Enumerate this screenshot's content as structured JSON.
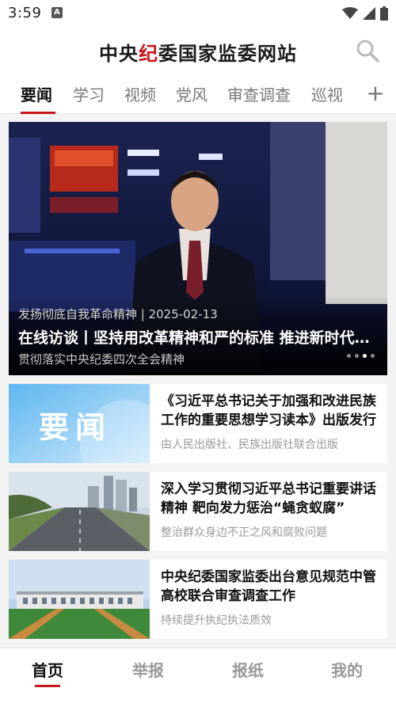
{
  "status_bar": {
    "time": "3:59",
    "app_icon_letter": "A",
    "icons": [
      "wifi-icon",
      "signal-icon",
      "battery-icon"
    ]
  },
  "header": {
    "title_part1": "中央",
    "title_highlight": "纪",
    "title_part2": "委国家监委网站",
    "accent_color": "#c8161d"
  },
  "tabs": [
    {
      "label": "要闻",
      "active": true
    },
    {
      "label": "学习"
    },
    {
      "label": "视频"
    },
    {
      "label": "党风"
    },
    {
      "label": "审查调查"
    },
    {
      "label": "巡视"
    }
  ],
  "tab_add_label": "+",
  "hero": {
    "tag": "发扬彻底自我革命精神 | 2025-02-13",
    "title": "在线访谈丨坚持用改革精神和严的标准 推进新时代纪检监察工作高质量发展",
    "subtitle": "贯彻落实中央纪委四次全会精神",
    "slide_count": 4,
    "active_slide": 2
  },
  "articles": [
    {
      "image_text": "要闻",
      "title": "《习近平总书记关于加强和改进民族工作的重要思想学习读本》出版发行",
      "source": "由人民出版社、民族出版社联合出版"
    },
    {
      "title": "深入学习贯彻习近平总书记重要讲话精神 靶向发力惩治“蝇贪蚁腐”",
      "source": "整治群众身边不正之风和腐败问题"
    },
    {
      "title": "中央纪委国家监委出台意见规范中管高校联合审查调查工作",
      "source": "持续提升执纪执法质效"
    }
  ],
  "bottom_nav": [
    {
      "label": "首页",
      "active": true
    },
    {
      "label": "举报"
    },
    {
      "label": "报纸"
    },
    {
      "label": "我的"
    }
  ]
}
